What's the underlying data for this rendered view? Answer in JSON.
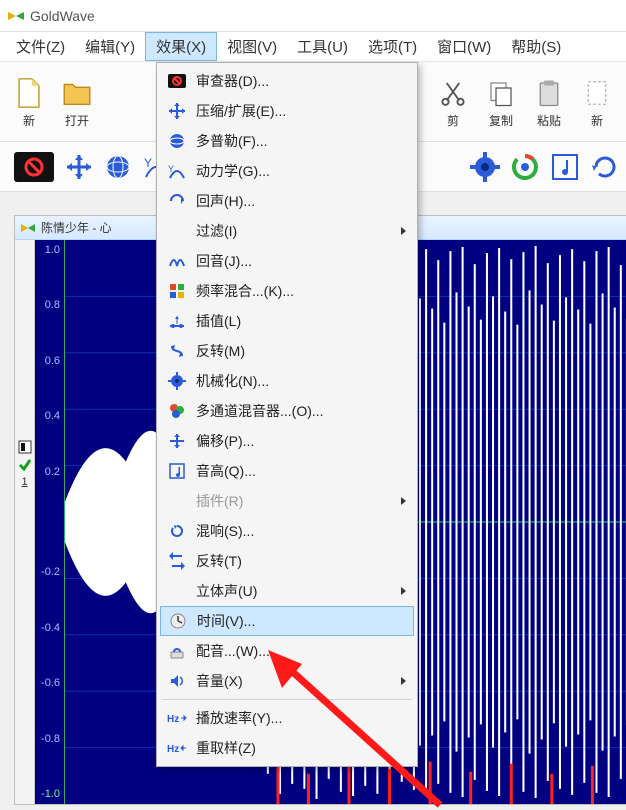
{
  "app": {
    "title": "GoldWave"
  },
  "menubar": {
    "items": [
      {
        "label": "文件(Z)"
      },
      {
        "label": "编辑(Y)"
      },
      {
        "label": "效果(X)",
        "active": true
      },
      {
        "label": "视图(V)"
      },
      {
        "label": "工具(U)"
      },
      {
        "label": "选项(T)"
      },
      {
        "label": "窗口(W)"
      },
      {
        "label": "帮助(S)"
      }
    ]
  },
  "toolbar1": {
    "items": [
      {
        "name": "new",
        "label": "新"
      },
      {
        "name": "open",
        "label": "打开"
      },
      {
        "name": "cut",
        "label": "剪"
      },
      {
        "name": "copy",
        "label": "复制"
      },
      {
        "name": "paste",
        "label": "粘贴"
      },
      {
        "name": "new2",
        "label": "新"
      }
    ]
  },
  "document": {
    "title": "陈情少年 - 心"
  },
  "ruler": {
    "ticks": [
      "1.0",
      "0.8",
      "0.6",
      "0.4",
      "0.2",
      "-0.2",
      "-0.4",
      "-0.6",
      "-0.8",
      "-1.0"
    ],
    "channel": "1"
  },
  "dropdown": {
    "items": [
      {
        "icon": "censor",
        "label": "审查器(D)..."
      },
      {
        "icon": "compress",
        "label": "压缩/扩展(E)..."
      },
      {
        "icon": "doppler",
        "label": "多普勒(F)..."
      },
      {
        "icon": "dynamics",
        "label": "动力学(G)..."
      },
      {
        "icon": "echo",
        "label": "回声(H)..."
      },
      {
        "icon": "filter",
        "label": "过滤(I)",
        "submenu": true
      },
      {
        "icon": "flanger",
        "label": "回音(J)..."
      },
      {
        "icon": "freqblend",
        "label": "频率混合...(K)..."
      },
      {
        "icon": "interp",
        "label": "插值(L)"
      },
      {
        "icon": "invert",
        "label": "反转(M)"
      },
      {
        "icon": "mech",
        "label": "机械化(N)..."
      },
      {
        "icon": "multimix",
        "label": "多通道混音器...(O)..."
      },
      {
        "icon": "offset",
        "label": "偏移(P)..."
      },
      {
        "icon": "pitch",
        "label": "音高(Q)..."
      },
      {
        "icon": "plugin",
        "label": "插件(R)",
        "disabled": true,
        "submenu": true
      },
      {
        "icon": "reverb",
        "label": "混响(S)..."
      },
      {
        "icon": "reverse",
        "label": "反转(T)"
      },
      {
        "icon": "stereo",
        "label": "立体声(U)",
        "submenu": true
      },
      {
        "icon": "time",
        "label": "时间(V)...",
        "highlight": true
      },
      {
        "icon": "voice",
        "label": "配音...(W)..."
      },
      {
        "icon": "volume",
        "label": "音量(X)",
        "submenu": true
      },
      {
        "sep": true
      },
      {
        "icon": "speed",
        "label": "播放速率(Y)..."
      },
      {
        "icon": "resample",
        "label": "重取样(Z)"
      }
    ]
  }
}
